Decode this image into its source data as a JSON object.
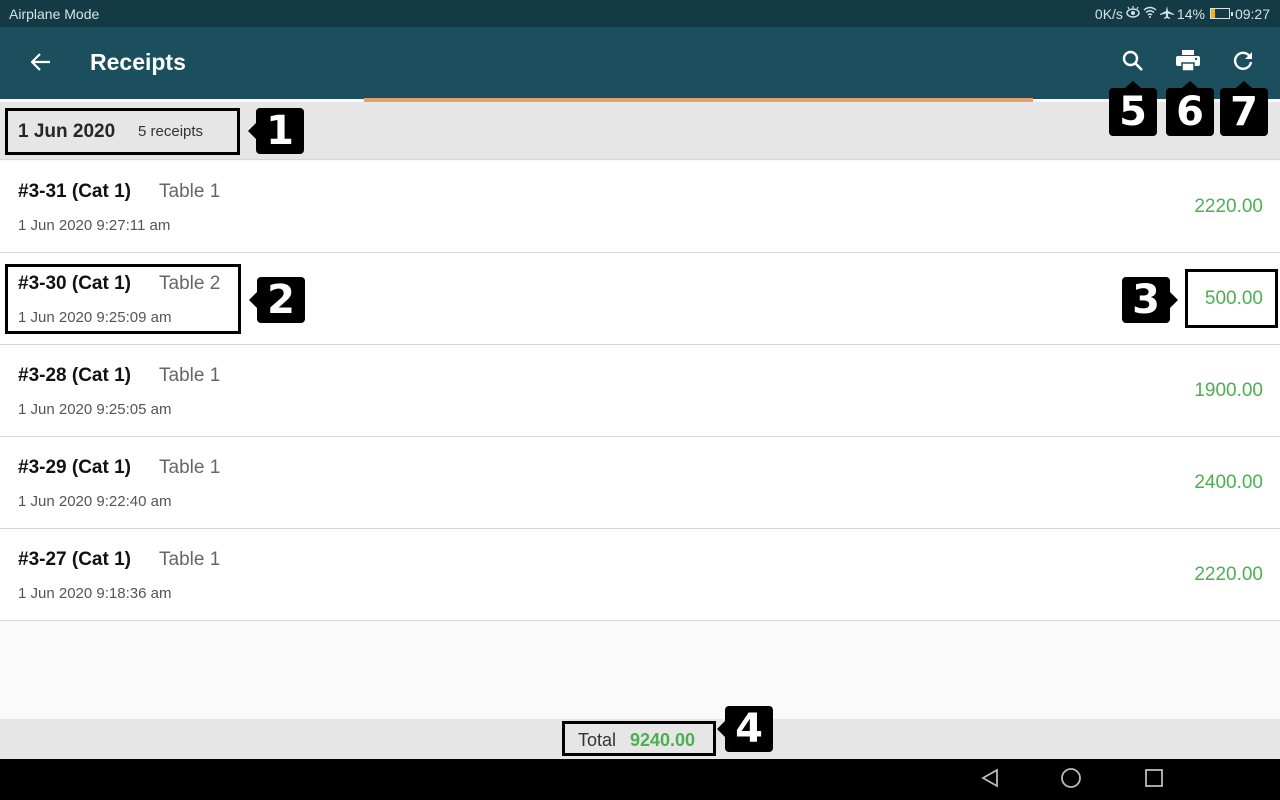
{
  "status_bar": {
    "left_text": "Airplane Mode",
    "net_speed": "0K/s",
    "battery_percent": "14%",
    "time": "09:27",
    "icons": [
      "eye-comfort-icon",
      "wifi-icon",
      "airplane-icon",
      "battery-icon"
    ]
  },
  "app_bar": {
    "title": "Receipts",
    "back_icon": "arrow-left-icon",
    "actions": [
      {
        "name": "search",
        "icon": "search-icon"
      },
      {
        "name": "print",
        "icon": "printer-icon"
      },
      {
        "name": "refresh",
        "icon": "refresh-icon"
      }
    ]
  },
  "colors": {
    "app_bar": "#1c4f5e",
    "status_bar": "#133a45",
    "amount": "#4caf50",
    "progress": "#e2a070"
  },
  "group": {
    "date": "1 Jun 2020",
    "count": "5 receipts"
  },
  "receipts": [
    {
      "id": "#3-31 (Cat 1)",
      "table": "Table 1",
      "time": "1 Jun 2020 9:27:11 am",
      "amount": "2220.00"
    },
    {
      "id": "#3-30 (Cat 1)",
      "table": "Table 2",
      "time": "1 Jun 2020 9:25:09 am",
      "amount": "500.00"
    },
    {
      "id": "#3-28 (Cat 1)",
      "table": "Table 1",
      "time": "1 Jun 2020 9:25:05 am",
      "amount": "1900.00"
    },
    {
      "id": "#3-29 (Cat 1)",
      "table": "Table 1",
      "time": "1 Jun 2020 9:22:40 am",
      "amount": "2400.00"
    },
    {
      "id": "#3-27 (Cat 1)",
      "table": "Table 1",
      "time": "1 Jun 2020 9:18:36 am",
      "amount": "2220.00"
    }
  ],
  "footer": {
    "total_label": "Total",
    "total_value": "9240.00"
  },
  "annotations": [
    "1",
    "2",
    "3",
    "4",
    "5",
    "6",
    "7"
  ],
  "nav_bar": {
    "buttons": [
      "back-icon",
      "home-icon",
      "recents-icon"
    ]
  }
}
